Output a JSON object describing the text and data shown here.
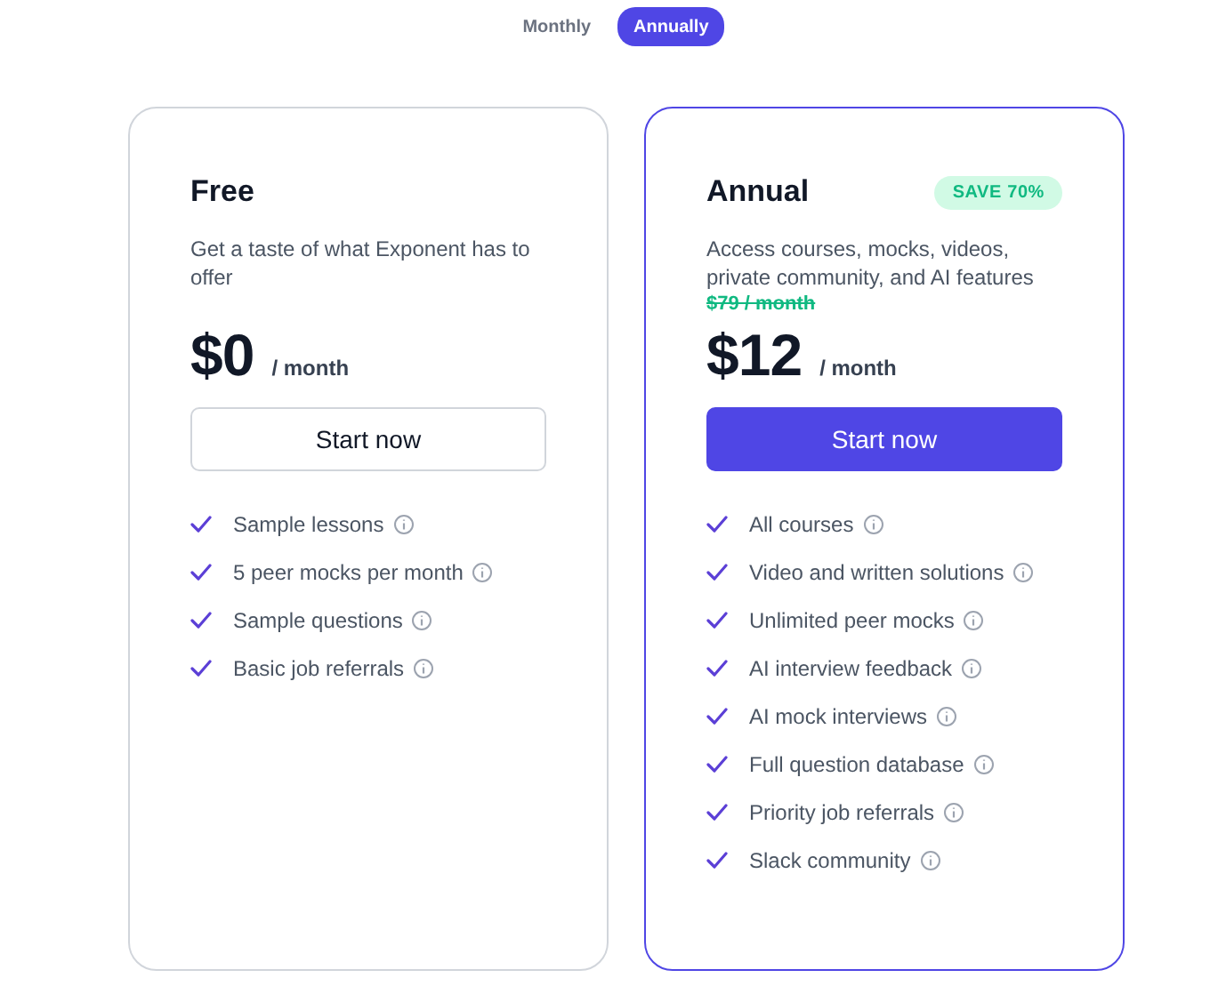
{
  "billing_toggle": [
    {
      "label": "Monthly",
      "selected": false
    },
    {
      "label": "Annually",
      "selected": true
    }
  ],
  "plans": [
    {
      "name": "Free",
      "highlighted": false,
      "description": "Get a taste of what Exponent has to offer",
      "price": "$0",
      "period": "/ month",
      "button": "Start now",
      "features": [
        "Sample lessons",
        "5 peer mocks per month",
        "Sample questions",
        "Basic job referrals"
      ]
    },
    {
      "name": "Annual",
      "highlighted": true,
      "badge": "SAVE 70%",
      "description": "Access courses, mocks, videos, private community, and AI features",
      "old_price": "$79 / month",
      "price": "$12",
      "period": "/ month",
      "button": "Start now",
      "features": [
        "All courses",
        "Video and written solutions",
        "Unlimited peer mocks",
        "AI interview feedback",
        "AI mock interviews",
        "Full question database",
        "Priority job referrals",
        "Slack community"
      ]
    }
  ]
}
